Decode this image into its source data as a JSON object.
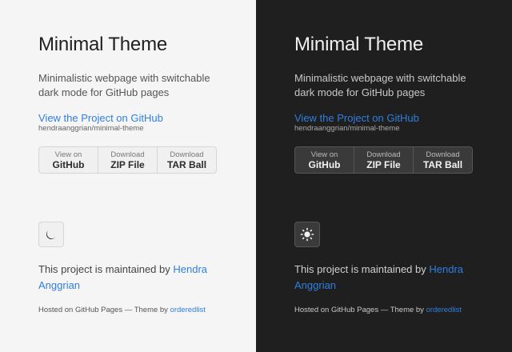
{
  "light": {
    "title": "Minimal Theme",
    "description": "Minimalistic webpage with switchable dark mode for GitHub pages",
    "project_link": "View the Project on GitHub",
    "repo": "hendraanggrian/minimal-theme",
    "buttons": [
      {
        "small": "View on",
        "big": "GitHub"
      },
      {
        "small": "Download",
        "big": "ZIP File"
      },
      {
        "small": "Download",
        "big": "TAR Ball"
      }
    ],
    "toggle_icon": "moon-icon",
    "maintained_prefix": "This project is maintained by ",
    "maintainer": "Hendra Anggrian",
    "hosted_prefix": "Hosted on GitHub Pages — Theme by ",
    "theme_author": "orderedlist"
  },
  "dark": {
    "title": "Minimal Theme",
    "description": "Minimalistic webpage with switchable dark mode for GitHub pages",
    "project_link": "View the Project on GitHub",
    "repo": "hendraanggrian/minimal-theme",
    "buttons": [
      {
        "small": "View on",
        "big": "GitHub"
      },
      {
        "small": "Download",
        "big": "ZIP File"
      },
      {
        "small": "Download",
        "big": "TAR Ball"
      }
    ],
    "toggle_icon": "sun-icon",
    "maintained_prefix": "This project is maintained by ",
    "maintainer": "Hendra Anggrian",
    "hosted_prefix": "Hosted on GitHub Pages — Theme by ",
    "theme_author": "orderedlist"
  },
  "colors": {
    "light_bg": "#f5f5f5",
    "dark_bg": "#1f1f1f",
    "link": "#2f7fe0"
  }
}
